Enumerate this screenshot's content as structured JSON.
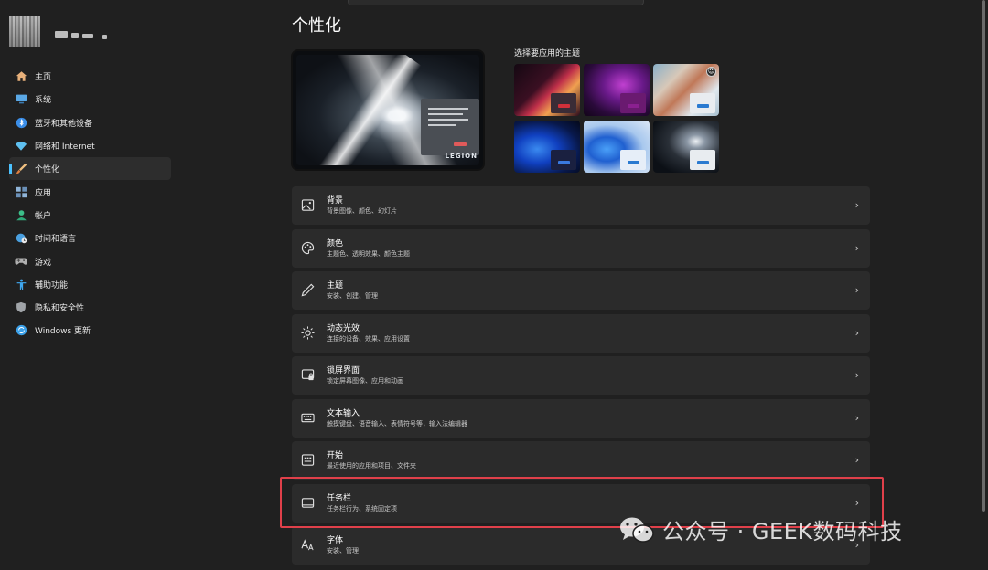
{
  "page": {
    "title": "个性化"
  },
  "sidebar": {
    "items": [
      {
        "label": "主页",
        "icon": "home-icon",
        "color": "#e8b07a"
      },
      {
        "label": "系统",
        "icon": "monitor-icon",
        "color": "#5aa8e6"
      },
      {
        "label": "蓝牙和其他设备",
        "icon": "bluetooth-icon",
        "color": "#3b8ee8"
      },
      {
        "label": "网络和 Internet",
        "icon": "wifi-icon",
        "color": "#5ec0f0"
      },
      {
        "label": "个性化",
        "icon": "brush-icon",
        "color": "#e8a050",
        "active": true
      },
      {
        "label": "应用",
        "icon": "apps-icon",
        "color": "#8fb4d8"
      },
      {
        "label": "帐户",
        "icon": "user-icon",
        "color": "#3cbf8a"
      },
      {
        "label": "时间和语言",
        "icon": "globe-clock-icon",
        "color": "#4aa0e0"
      },
      {
        "label": "游戏",
        "icon": "gamepad-icon",
        "color": "#b0b0b0"
      },
      {
        "label": "辅助功能",
        "icon": "accessibility-icon",
        "color": "#3fa8f0"
      },
      {
        "label": "隐私和安全性",
        "icon": "shield-icon",
        "color": "#a0a4a8"
      },
      {
        "label": "Windows 更新",
        "icon": "update-icon",
        "color": "#3ba0e8"
      }
    ]
  },
  "themes": {
    "label": "选择要应用的主题",
    "items": [
      {
        "name": "glow-theme",
        "bg": "linear-gradient(135deg,#140812 0%,#3a0f22 40%,#c0304a 55%,#f0a050 70%,#2a0b1c 100%)",
        "window": "#3a2c36",
        "button": "#d0303a"
      },
      {
        "name": "purple-theme",
        "bg": "radial-gradient(ellipse at 60% 40%,#c040d0 0%,#6a1a8a 35%,#2a0a3a 70%,#120418 100%)",
        "window": "#6a1a70",
        "button": "#8a2090"
      },
      {
        "name": "nature-theme",
        "bg": "linear-gradient(135deg,#8ab0c8 0%,#d8c8b8 30%,#c07858 50%,#e0e8ee 75%,#a8c0d0 100%)",
        "window": "#e8ecf0",
        "button": "#2a7ad0",
        "selected": true
      },
      {
        "name": "bloom-dark-theme",
        "bg": "radial-gradient(ellipse at 35% 55%,#3a8af0 0%,#1040c0 35%,#08184a 70%,#040818 100%)",
        "window": "#1a2040",
        "button": "#3a7ae0"
      },
      {
        "name": "bloom-light-theme",
        "bg": "radial-gradient(ellipse at 35% 55%,#4aa0f8 0%,#2060d0 30%,#a8c8ee 60%,#dce8f6 100%)",
        "window": "#e6eef8",
        "button": "#2a7ad0"
      },
      {
        "name": "legion-theme",
        "bg": "radial-gradient(ellipse at 65% 40%,#eef2f6 0%,#8a96a4 15%,#2a3038 45%,#0c1016 80%)",
        "window": "#e8ecf0",
        "button": "#2a7ad0"
      }
    ]
  },
  "preview": {
    "logo_text": "LEGION"
  },
  "settings": [
    {
      "title": "背景",
      "subtitle": "背景图像、颜色、幻灯片",
      "icon": "image-icon"
    },
    {
      "title": "颜色",
      "subtitle": "主题色、透明效果、颜色主题",
      "icon": "palette-icon"
    },
    {
      "title": "主题",
      "subtitle": "安装、创建、管理",
      "icon": "pen-icon"
    },
    {
      "title": "动态光效",
      "subtitle": "连接的设备、效果、应用设置",
      "icon": "light-icon"
    },
    {
      "title": "锁屏界面",
      "subtitle": "锁定屏幕图像、应用和动画",
      "icon": "lock-screen-icon"
    },
    {
      "title": "文本输入",
      "subtitle": "触摸键盘、语音输入、表情符号等，输入法编辑器",
      "icon": "keyboard-icon"
    },
    {
      "title": "开始",
      "subtitle": "最近使用的应用和项目、文件夹",
      "icon": "start-icon"
    },
    {
      "title": "任务栏",
      "subtitle": "任务栏行为、系统固定项",
      "icon": "taskbar-icon",
      "highlighted": true
    },
    {
      "title": "字体",
      "subtitle": "安装、管理",
      "icon": "font-icon"
    }
  ],
  "watermark": {
    "text": "公众号 · GEEK数码科技"
  },
  "colors": {
    "background": "#202020",
    "card": "#2b2b2b",
    "accent": "#4cc2ff",
    "highlight": "#e0404a"
  }
}
